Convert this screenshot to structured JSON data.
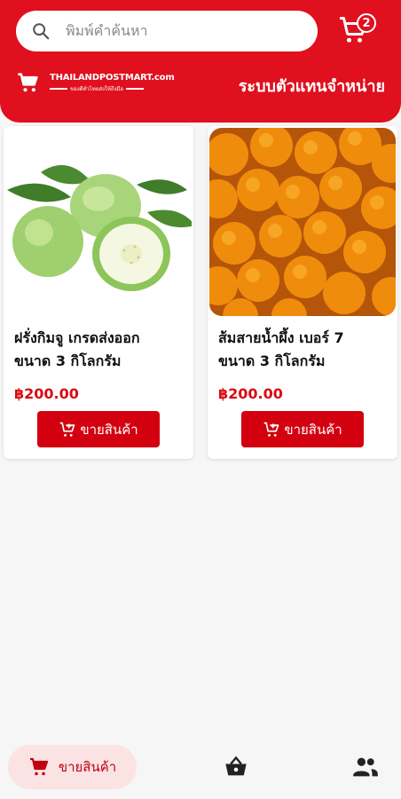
{
  "search": {
    "placeholder": "พิมพ์คำค้นหา"
  },
  "cart": {
    "badge_count": "2"
  },
  "logo": {
    "main": "THAILANDPOSTMART.com",
    "sub": "ของดีทั่วไทยส่งให้ถึงมือ"
  },
  "header": {
    "title": "ระบบตัวแทนจำหน่าย"
  },
  "products": [
    {
      "name_line1": "ฝรั่งกิมจู เกรดส่งออก",
      "name_line2": "ขนาด 3 กิโลกรัม",
      "price": "฿200.00",
      "button": "ขายสินค้า"
    },
    {
      "name_line1": "ส้มสายน้ำผึ้ง เบอร์ 7",
      "name_line2": "ขนาด 3 กิโลกรัม",
      "price": "฿200.00",
      "button": "ขายสินค้า"
    }
  ],
  "bottom_nav": {
    "sell_label": "ขายสินค้า"
  },
  "colors": {
    "brand_red": "#e0101e",
    "button_red": "#d30010",
    "price_red": "#d90b12",
    "nav_pill": "#fbe3e4"
  },
  "icons": [
    "search-icon",
    "cart-icon",
    "basket-icon",
    "users-icon",
    "add-cart-icon"
  ]
}
